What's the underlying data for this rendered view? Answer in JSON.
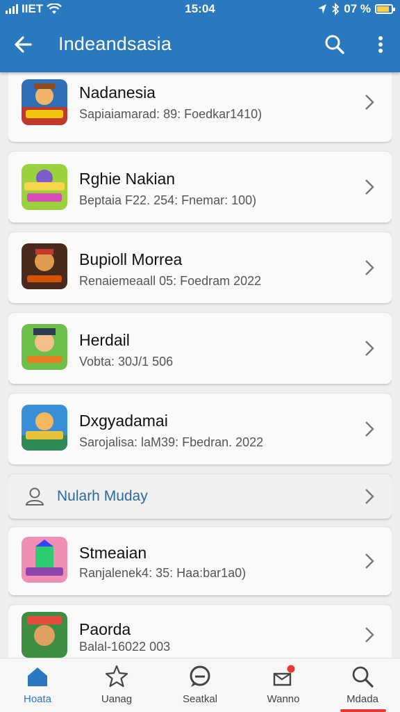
{
  "status_bar": {
    "carrier": "IIET",
    "time": "15:04",
    "battery_text": "07 %"
  },
  "app_bar": {
    "title": "Indeandsasia"
  },
  "items": [
    {
      "name": "Nadanesia",
      "meta": "Sapiaiamarad: 89: Foedkar1410)",
      "thumb": "game-1"
    },
    {
      "name": "Rghie Nakian",
      "meta": "Beptaia F22. 254: Fnemar: 100)",
      "thumb": "game-2"
    },
    {
      "name": "Bupioll Morrea",
      "meta": "Renaiemeaall 05: Foedram 2022",
      "thumb": "game-3"
    },
    {
      "name": "Herdail",
      "meta": "Vobta: 30J/1 506",
      "thumb": "game-4"
    },
    {
      "name": "Dxgyadamai",
      "meta": "Sarojalisa: laM39: Fbedran. 2022",
      "thumb": "game-5"
    }
  ],
  "user_row": {
    "label": "Nularh Muday"
  },
  "items_after": [
    {
      "name": "Stmeaian",
      "meta": "Ranjalenek4: 35: Haa:bar1a0)",
      "thumb": "game-6"
    },
    {
      "name": "Paorda",
      "meta": "Balal-16022 003",
      "thumb": "game-7"
    }
  ],
  "bottom_nav": [
    {
      "label": "Hoata",
      "icon": "home-icon",
      "active": true
    },
    {
      "label": "Uanag",
      "icon": "star-icon",
      "active": false
    },
    {
      "label": "Seatkal",
      "icon": "chat-icon",
      "active": false
    },
    {
      "label": "Wanno",
      "icon": "notification-icon",
      "active": false
    },
    {
      "label": "Mdada",
      "icon": "search-icon",
      "active": false
    }
  ],
  "colors": {
    "app_bar": "#2a78bd",
    "accent": "#2a78bd",
    "badge": "#e53935"
  }
}
